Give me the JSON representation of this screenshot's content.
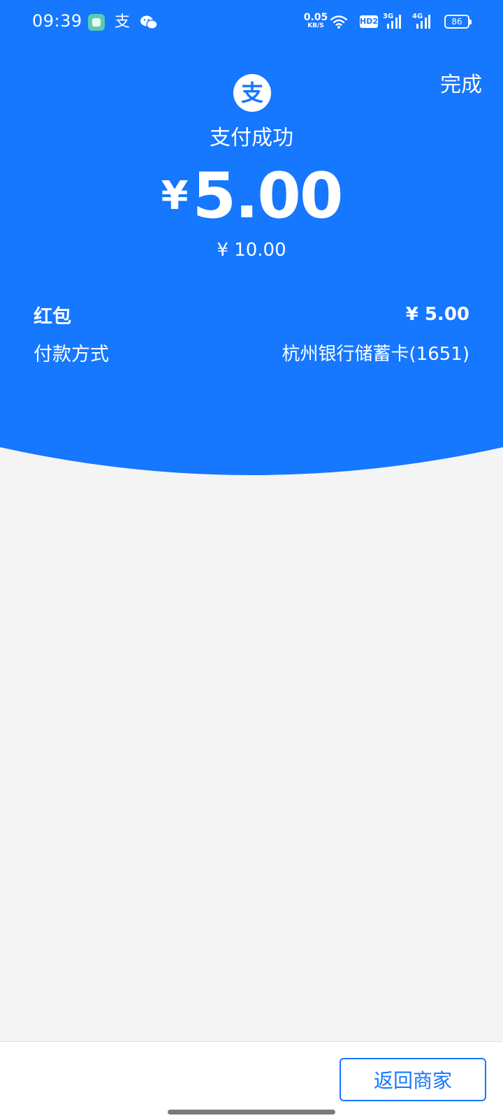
{
  "status_bar": {
    "time": "09:39",
    "alipay_glyph": "支",
    "net_speed_value": "0.05",
    "net_speed_unit": "KB/S",
    "hd_label": "HD2",
    "signal1_label": "3G",
    "signal2_label": "4G",
    "battery": "86",
    "icons": [
      "app-notification-icon",
      "alipay-icon",
      "wechat-icon",
      "wifi-icon",
      "signal-icon",
      "battery-icon"
    ]
  },
  "header": {
    "done_label": "完成",
    "logo_glyph": "支",
    "title": "支付成功"
  },
  "payment": {
    "currency": "¥",
    "amount": "5.00",
    "original_amount": "¥ 10.00"
  },
  "details": {
    "red_packet_label": "红包",
    "red_packet_value": "¥ 5.00",
    "method_label": "付款方式",
    "method_value": "杭州银行储蓄卡(1651)"
  },
  "footer": {
    "back_label": "返回商家"
  },
  "colors": {
    "brand_blue": "#1677ff",
    "page_bg": "#f4f4f4"
  }
}
